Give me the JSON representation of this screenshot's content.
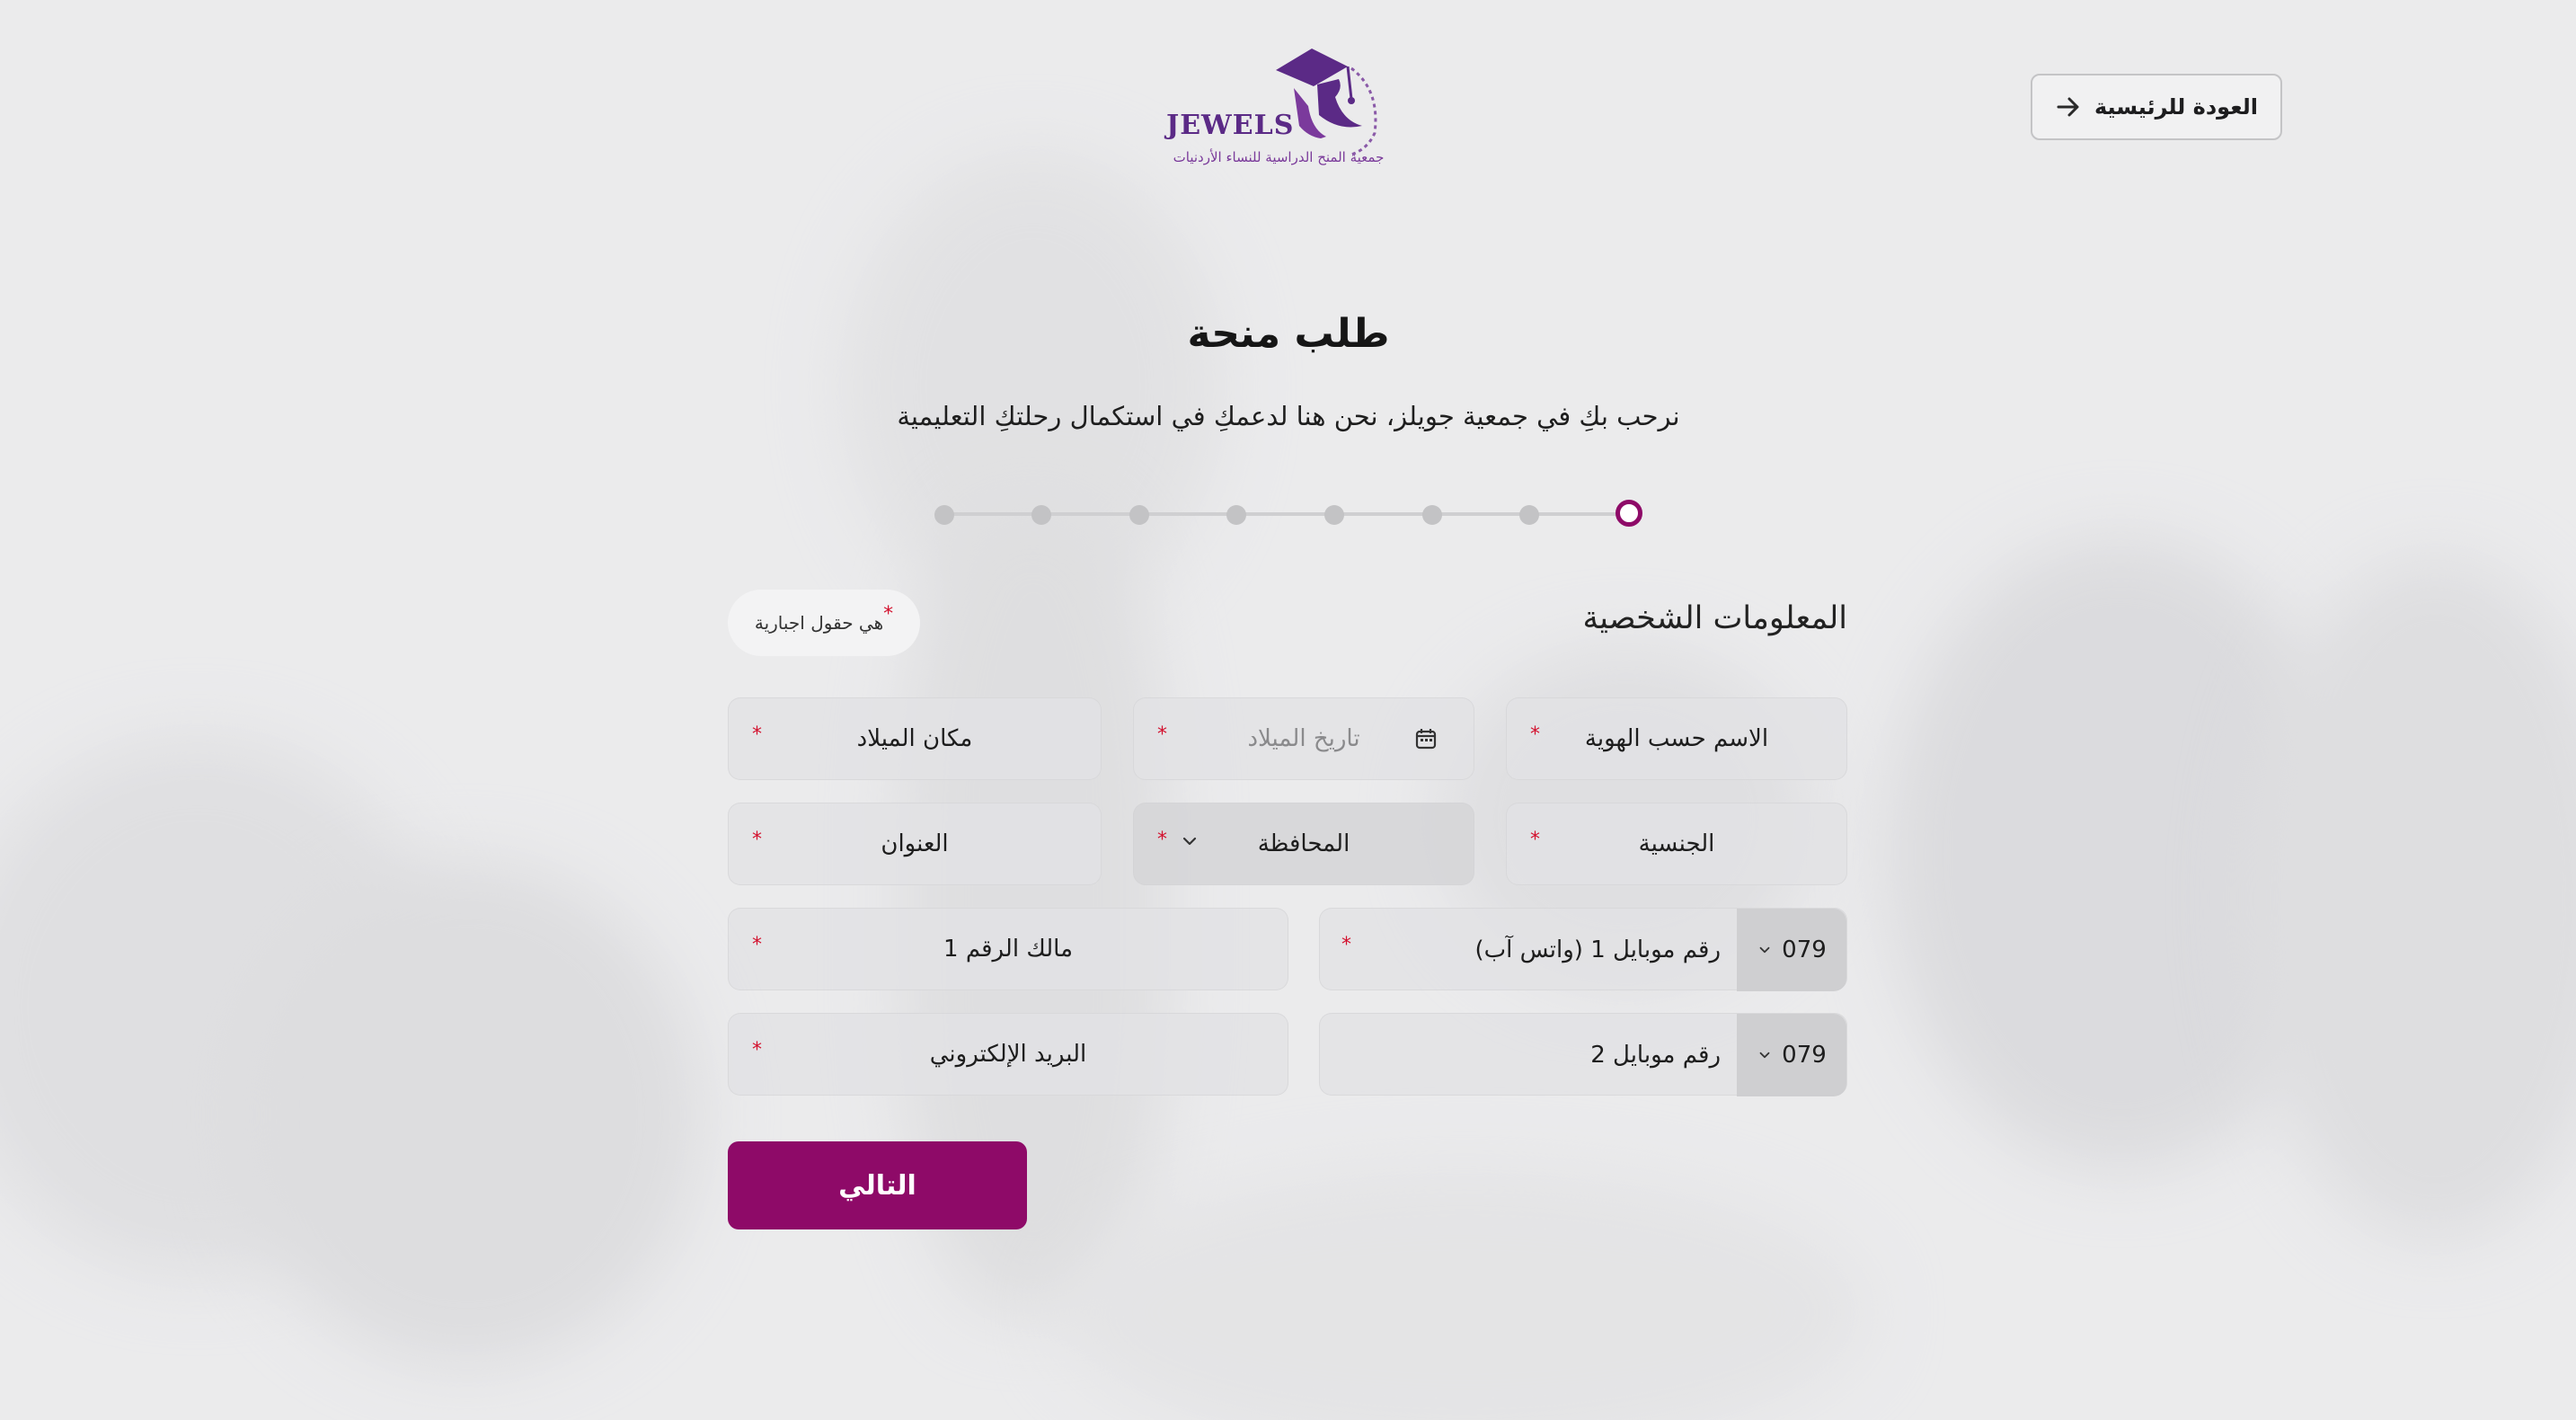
{
  "colors": {
    "primary": "#8e0a68",
    "required": "#d3102d",
    "logo": "#5b2a86"
  },
  "header": {
    "logo_word": "JEWELS",
    "logo_tagline": "جمعية المنح الدراسية للنساء الأردنيات",
    "logo_icon": "graduation-cap-profile-icon",
    "back_label": "العودة للرئيسية",
    "back_icon": "arrow-right-icon"
  },
  "intro": {
    "title": "طلب منحة",
    "subtitle": "نرحب بكِ في جمعية جويلز، نحن هنا لدعمكِ في استكمال رحلتكِ التعليمية"
  },
  "stepper": {
    "total_steps": 8,
    "current_step": 1
  },
  "section": {
    "title": "المعلومات الشخصية",
    "required_note": "هي حقول اجبارية",
    "required_mark": "*"
  },
  "fields": {
    "full_name": "الاسم حسب الهوية",
    "birth_date": "تاريخ الميلاد",
    "birth_place": "مكان الميلاد",
    "nationality": "الجنسية",
    "governorate": "المحافظة",
    "address": "العنوان",
    "mobile1": "رقم موبايل 1 (واتس آب)",
    "mobile1_code": "079",
    "owner1": "مالك الرقم 1",
    "mobile2": "رقم موبايل 2",
    "mobile2_code": "079",
    "email": "البريد الإلكتروني"
  },
  "actions": {
    "next_label": "التالي"
  }
}
